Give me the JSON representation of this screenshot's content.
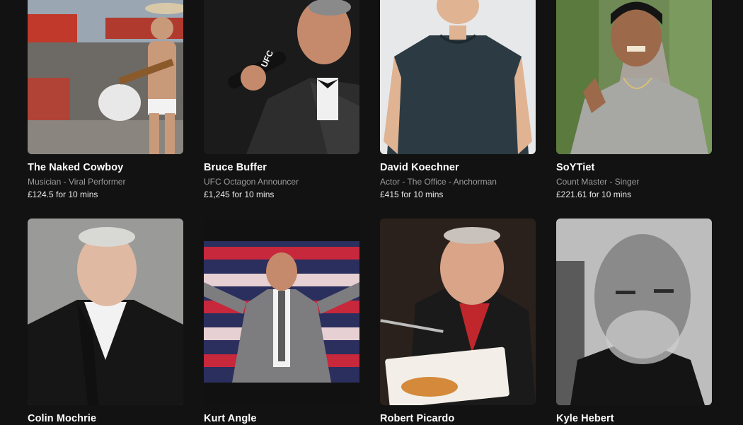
{
  "talent": [
    {
      "name": "The Naked Cowboy",
      "subtitle": "Musician - Viral Performer",
      "price": "£124.5 for 10 mins"
    },
    {
      "name": "Bruce Buffer",
      "subtitle": "UFC Octagon Announcer",
      "price": "£1,245 for 10 mins"
    },
    {
      "name": "David Koechner",
      "subtitle": "Actor - The Office - Anchorman",
      "price": "£415 for 10 mins"
    },
    {
      "name": "SoYTiet",
      "subtitle": "Count Master - Singer",
      "price": "£221.61 for 10 mins"
    },
    {
      "name": "Colin Mochrie"
    },
    {
      "name": "Kurt Angle"
    },
    {
      "name": "Robert Picardo"
    },
    {
      "name": "Kyle Hebert"
    }
  ],
  "colors": {
    "background": "#121212",
    "subtitle": "#9b9b9b",
    "price": "#e8e8e8"
  }
}
